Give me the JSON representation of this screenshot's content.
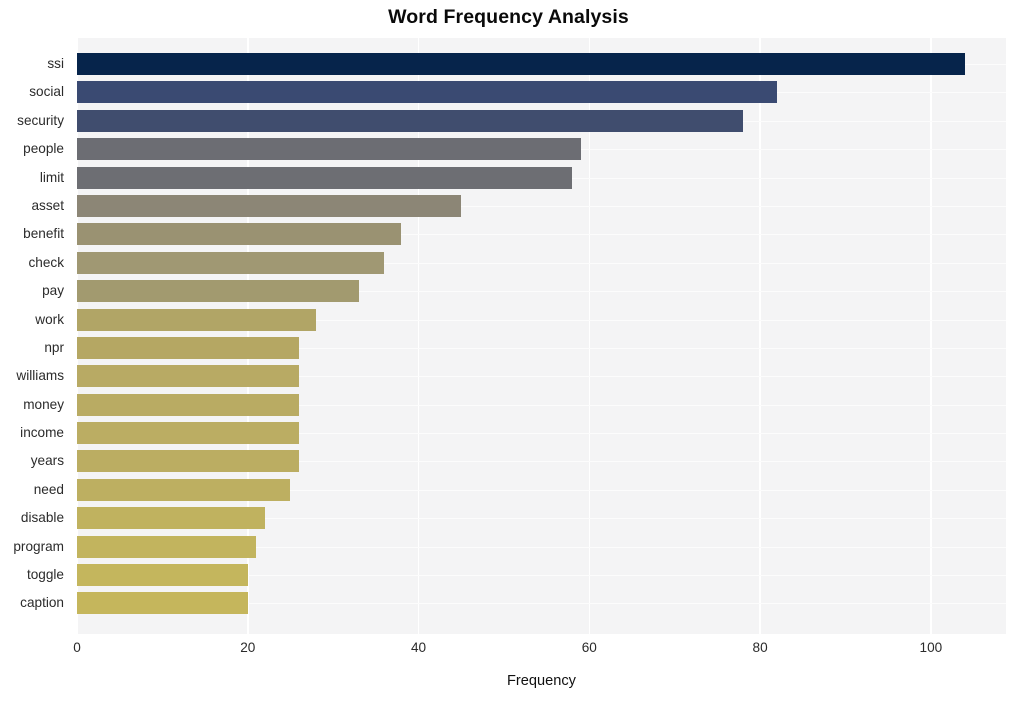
{
  "chart_data": {
    "type": "bar",
    "orientation": "horizontal",
    "title": "Word Frequency Analysis",
    "xlabel": "Frequency",
    "ylabel": "",
    "categories": [
      "ssi",
      "social",
      "security",
      "people",
      "limit",
      "asset",
      "benefit",
      "check",
      "pay",
      "work",
      "npr",
      "williams",
      "money",
      "income",
      "years",
      "need",
      "disable",
      "program",
      "toggle",
      "caption"
    ],
    "values": [
      104,
      82,
      78,
      59,
      58,
      45,
      38,
      36,
      33,
      28,
      26,
      26,
      26,
      26,
      26,
      25,
      22,
      21,
      20,
      20
    ],
    "bar_colors": [
      "#06244b",
      "#3a4a72",
      "#404d6e",
      "#6c6d73",
      "#6d6e73",
      "#8c8676",
      "#9a9272",
      "#a09873",
      "#a29a6f",
      "#b1a566",
      "#b5a763",
      "#b8aa64",
      "#b9ab63",
      "#bbad63",
      "#bbad62",
      "#bdaf61",
      "#c0b25f",
      "#c2b45e",
      "#c4b65d",
      "#c5b65c"
    ],
    "xlim": [
      0,
      108.8
    ],
    "xticks": [
      0,
      20,
      40,
      60,
      80,
      100
    ],
    "xticklabels": [
      "0",
      "20",
      "40",
      "60",
      "80",
      "100"
    ],
    "grid": true,
    "grid_color": "#ffffff",
    "plot_background": "#f4f4f5",
    "figure_background": "#ffffff",
    "legend": null
  }
}
